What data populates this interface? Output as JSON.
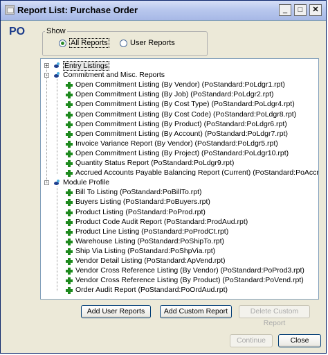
{
  "window": {
    "title": "Report List: Purchase Order",
    "min": "_",
    "max": "□",
    "close": "✕"
  },
  "module_label": "PO",
  "show": {
    "legend": "Show",
    "all_reports": "All Reports",
    "user_reports": "User Reports",
    "selected": "all_reports"
  },
  "tree": {
    "entry_listings": {
      "label": "Entry Listings",
      "expander": "+"
    },
    "commitment": {
      "label": "Commitment and Misc. Reports",
      "expander": "-",
      "items": [
        "Open Commitment Listing (By Vendor)  (PoStandard:PoLdgr1.rpt)",
        "Open Commitment Listing (By Job)  (PoStandard:PoLdgr2.rpt)",
        "Open Commitment Listing (By Cost Type)  (PoStandard:PoLdgr4.rpt)",
        "Open Commitment Listing (By Cost Code)  (PoStandard:PoLdgr8.rpt)",
        "Open Commitment Listing (By Product)  (PoStandard:PoLdgr6.rpt)",
        "Open Commitment Listing (By Account)  (PoStandard:PoLdgr7.rpt)",
        "Invoice Variance Report (By Vendor)  (PoStandard:PoLdgr5.rpt)",
        "Open Commitment Listing (By Project)  (PoStandard:PoLdgr10.rpt)",
        "Quantity Status Report  (PoStandard:PoLdgr9.rpt)",
        "Accrued Accounts Payable Balancing Report (Current)  (PoStandard:PoAccrAP.rpt)"
      ]
    },
    "module": {
      "label": "Module Profile",
      "expander": "-",
      "items": [
        "Bill To Listing  (PoStandard:PoBillTo.rpt)",
        "Buyers Listing  (PoStandard:PoBuyers.rpt)",
        "Product Listing  (PoStandard:PoProd.rpt)",
        "Product Code Audit Report  (PoStandard:ProdAud.rpt)",
        "Product Line Listing  (PoStandard:PoProdCt.rpt)",
        "Warehouse Listing  (PoStandard:PoShipTo.rpt)",
        "Ship Via Listing  (PoStandard:PoShpVia.rpt)",
        "Vendor Detail Listing  (PoStandard:ApVend.rpt)",
        "Vendor Cross Reference Listing (By Vendor)  (PoStandard:PoProd3.rpt)",
        "Vendor Cross Reference Listing (By Product)  (PoStandard:PoVend.rpt)",
        "Order Audit Report  (PoStandard:PoOrdAud.rpt)"
      ]
    }
  },
  "buttons": {
    "add_user": "Add User Reports",
    "add_custom": "Add Custom Report",
    "delete_custom": "Delete Custom Report",
    "continue": "Continue",
    "close": "Close"
  }
}
